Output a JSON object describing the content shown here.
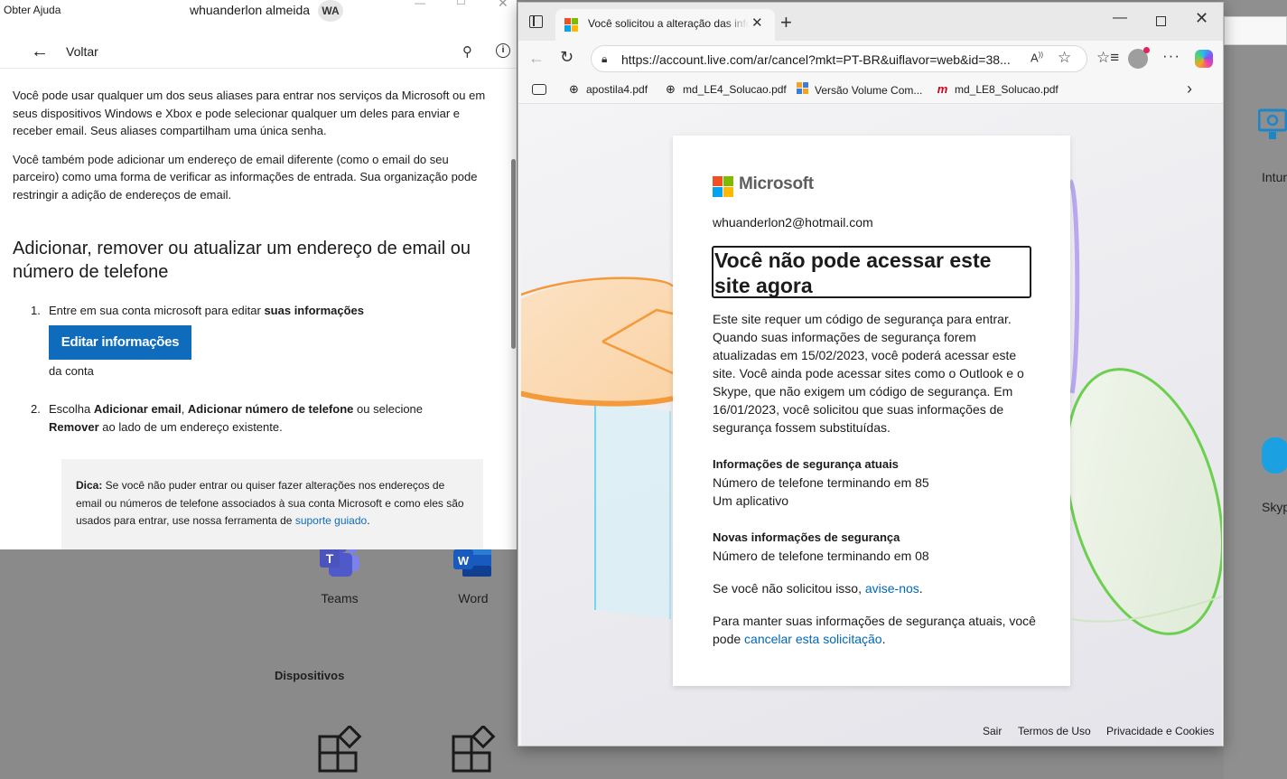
{
  "background": {
    "apps": [
      {
        "label": "Teams",
        "icon": "teams-icon"
      },
      {
        "label": "Word",
        "icon": "word-icon"
      }
    ],
    "devices_label": "Dispositivos",
    "right_apps": [
      {
        "label": "Intun",
        "icon": "intune-icon"
      },
      {
        "label": "Skyp",
        "icon": "skype-icon"
      }
    ]
  },
  "help_window": {
    "app_name": "Obter Ajuda",
    "user_name": "whuanderlon almeida",
    "avatar_initials": "WA",
    "back_label": "Voltar",
    "paragraphs": [
      "Você pode usar qualquer um dos seus aliases para entrar nos serviços da Microsoft ou em seus dispositivos Windows e Xbox e pode selecionar qualquer um deles para enviar e receber email. Seus aliases compartilham uma única senha.",
      "Você também pode adicionar um endereço de email diferente (como o email do seu parceiro) como uma forma de verificar as informações de entrada. Sua organização pode restringir a adição de endereços de email."
    ],
    "heading": "Adicionar, remover ou atualizar um endereço de email ou número de telefone",
    "step1": {
      "num": "1.",
      "text": "Entre em sua conta microsoft para editar ",
      "bold": "suas informações",
      "button": "Editar informações",
      "after": "da conta"
    },
    "step2": {
      "num": "2.",
      "t1": "Escolha ",
      "b1": "Adicionar email",
      "t2": ", ",
      "b2": "Adicionar número de telefone",
      "t3": " ou selecione ",
      "b3": "Remover",
      "t4": " ao lado de um endereço existente."
    },
    "tip": {
      "label": "Dica:",
      "text": " Se você não puder entrar ou quiser fazer alterações nos endereços de email ou números de telefone associados à sua conta Microsoft e como eles são usados para entrar, use nossa ferramenta de ",
      "link": "suporte guiado",
      "end": "."
    }
  },
  "browser": {
    "tab_title": "Você solicitou a alteração das informações de segurança",
    "url": "https://account.live.com/ar/cancel?mkt=PT-BR&uiflavor=web&id=38...",
    "bookmarks": [
      {
        "label": "apostila4.pdf",
        "icon": "globe-icon"
      },
      {
        "label": "md_LE4_Solucao.pdf",
        "icon": "globe-icon"
      },
      {
        "label": "Versão Volume Com...",
        "icon": "app-icon"
      },
      {
        "label": "md_LE8_Solucao.pdf",
        "icon": "m-icon"
      }
    ],
    "accent_color": "#0067b8"
  },
  "card": {
    "brand": "Microsoft",
    "email": "whuanderlon2@hotmail.com",
    "title": "Você não pode acessar este site agora",
    "body": "Este site requer um código de segurança para entrar. Quando suas informações de segurança forem atualizadas em 15/02/2023, você poderá acessar este site. Você ainda pode acessar sites como o Outlook e o Skype, que não exigem um código de segurança. Em 16/01/2023, você solicitou que suas informações de segurança fossem substituídas.",
    "current_label": "Informações de segurança atuais",
    "current_items": [
      "Número de telefone terminando em 85",
      "Um aplicativo"
    ],
    "new_label": "Novas informações de segurança",
    "new_items": [
      "Número de telefone terminando em 08"
    ],
    "notify_text": "Se você não solicitou isso, ",
    "notify_link": "avise-nos",
    "notify_end": ".",
    "keep_text": "Para manter suas informações de segurança atuais, você pode ",
    "keep_link": "cancelar esta solicitação",
    "keep_end": "."
  },
  "footer": {
    "signout": "Sair",
    "terms": "Termos de Uso",
    "privacy": "Privacidade e Cookies"
  }
}
